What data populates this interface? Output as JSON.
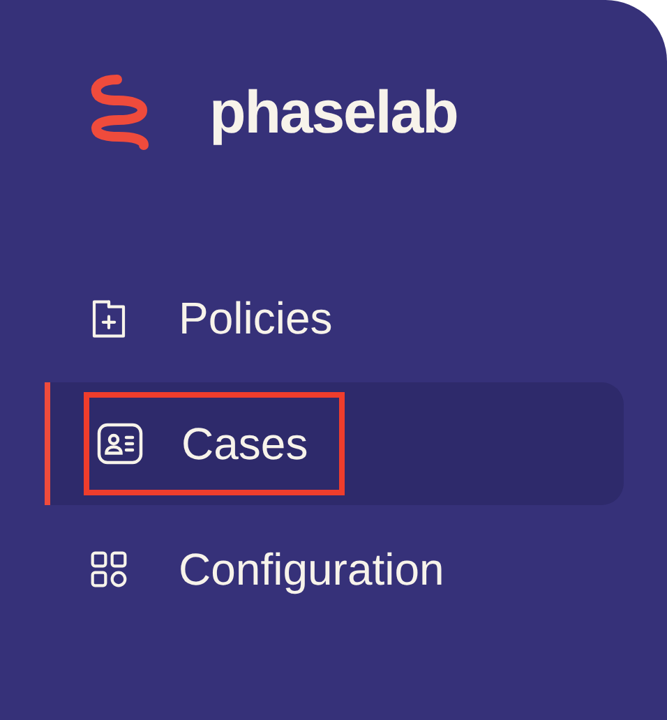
{
  "brand": {
    "name": "phaselab"
  },
  "nav": [
    {
      "label": "Policies",
      "kind": "folder-plus",
      "selected": false,
      "highlighted": false
    },
    {
      "label": "Cases",
      "kind": "contact-card",
      "selected": true,
      "highlighted": true
    },
    {
      "label": "Configuration",
      "kind": "grid",
      "selected": false,
      "highlighted": false
    }
  ]
}
